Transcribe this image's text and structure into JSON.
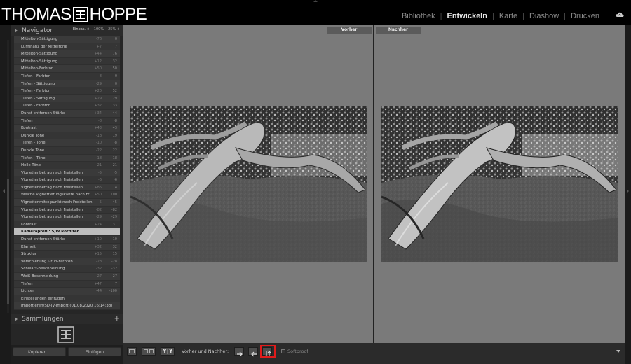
{
  "header": {
    "logo_left": "THOMAS",
    "logo_right": "HOPPE",
    "modules": [
      {
        "label": "Bibliothek",
        "active": false
      },
      {
        "label": "Entwickeln",
        "active": true
      },
      {
        "label": "Karte",
        "active": false
      },
      {
        "label": "Diashow",
        "active": false
      },
      {
        "label": "Drucken",
        "active": false
      }
    ],
    "cloud_icon": "cloud-icon"
  },
  "navigator": {
    "title": "Navigator",
    "zoom_options": [
      "Einpas. ⇕",
      "100%",
      "25% ⇕"
    ]
  },
  "history": {
    "items": [
      {
        "label": "Mittelton-Sättigung",
        "v1": "-76",
        "v2": "0"
      },
      {
        "label": "Luminanz der Mitteltöne",
        "v1": "+7",
        "v2": "7"
      },
      {
        "label": "Mittelton-Sättigung",
        "v1": "+44",
        "v2": "76"
      },
      {
        "label": "Mittelton-Sättigung",
        "v1": "+12",
        "v2": "32"
      },
      {
        "label": "Mittelton-Farbton",
        "v1": "+50",
        "v2": "50"
      },
      {
        "label": "Tiefen - Farbton",
        "v1": "-8",
        "v2": "0"
      },
      {
        "label": "Tiefen - Sättigung",
        "v1": "-29",
        "v2": "0"
      },
      {
        "label": "Tiefen - Farbton",
        "v1": "+20",
        "v2": "52"
      },
      {
        "label": "Tiefen - Sättigung",
        "v1": "+29",
        "v2": "29"
      },
      {
        "label": "Tiefen - Farbton",
        "v1": "+32",
        "v2": "33"
      },
      {
        "label": "Dunst entfernen-Stärke",
        "v1": "+34",
        "v2": "44"
      },
      {
        "label": "Tiefen",
        "v1": "-8",
        "v2": "-8"
      },
      {
        "label": "Kontrast",
        "v1": "+43",
        "v2": "43"
      },
      {
        "label": "Dunkle Töne",
        "v1": "-18",
        "v2": "19"
      },
      {
        "label": "Tiefen - Töne",
        "v1": "-10",
        "v2": "-8"
      },
      {
        "label": "Dunkle Töne",
        "v1": "-22",
        "v2": "22"
      },
      {
        "label": "Tiefen - Töne",
        "v1": "-18",
        "v2": "-18"
      },
      {
        "label": "Helle Töne",
        "v1": "-21",
        "v2": "21"
      },
      {
        "label": "Vignettenbetrag nach Freistellen",
        "v1": "-5",
        "v2": "-5"
      },
      {
        "label": "Vignettenbetrag nach Freistellen",
        "v1": "-6",
        "v2": "-6"
      },
      {
        "label": "Vignettenbetrag nach Freistellen",
        "v1": "+86",
        "v2": "4"
      },
      {
        "label": "Weiche Vignettierungskante nach Fr...",
        "v1": "+50",
        "v2": "100"
      },
      {
        "label": "Vignettenmittelpunkt nach Freistellen",
        "v1": "-5",
        "v2": "45"
      },
      {
        "label": "Vignettenbetrag nach Freistellen",
        "v1": "-82",
        "v2": "-82"
      },
      {
        "label": "Vignettenbetrag nach Freistellen",
        "v1": "-29",
        "v2": "-29"
      },
      {
        "label": "Kontrast",
        "v1": "+24",
        "v2": "31"
      },
      {
        "label": "Kameraprofil: S/W Rotfilter",
        "v1": "",
        "v2": "",
        "selected": true
      },
      {
        "label": "Dunst entfernen-Stärke",
        "v1": "+10",
        "v2": "10"
      },
      {
        "label": "Klarheit",
        "v1": "+32",
        "v2": "32"
      },
      {
        "label": "Struktur",
        "v1": "+15",
        "v2": "15"
      },
      {
        "label": "Verschiebung Grün-Farbton",
        "v1": "-28",
        "v2": "-28"
      },
      {
        "label": "Schwarz-Beschneidung",
        "v1": "-32",
        "v2": "-32"
      },
      {
        "label": "Weiß-Beschneidung",
        "v1": "-27",
        "v2": "-27"
      },
      {
        "label": "Tiefen",
        "v1": "+47",
        "v2": "7"
      },
      {
        "label": "Lichter",
        "v1": "-44",
        "v2": "-100"
      },
      {
        "label": "Einstellungen einfügen",
        "v1": "",
        "v2": ""
      },
      {
        "label": "Importieren/SD-IV-Import (01.08.2020 16:14:38)",
        "v1": "",
        "v2": ""
      }
    ]
  },
  "collections": {
    "title": "Sammlungen",
    "add_label": "+"
  },
  "left_buttons": {
    "copy_label": "Kopieren...",
    "paste_label": "Einfügen"
  },
  "main": {
    "before_label": "Vorher",
    "after_label": "Nachher"
  },
  "toolbar": {
    "view_y_label": "Y|Y",
    "before_after_label": "Vorher und Nachher:",
    "softproof_label": "Softproof",
    "softproof_checked": false
  },
  "colors": {
    "highlight": "#e01b1b",
    "panel": "#262626",
    "canvas": "#7a7a7a"
  }
}
